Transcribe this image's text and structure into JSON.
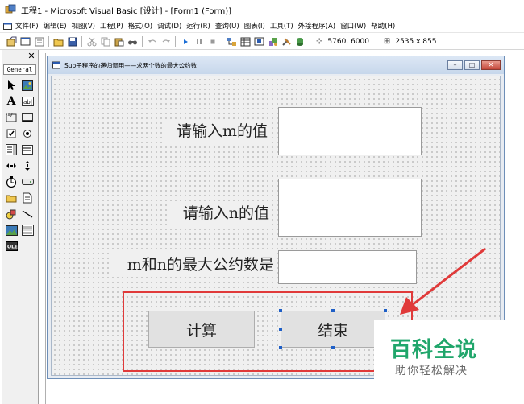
{
  "window": {
    "title": "工程1 - Microsoft Visual Basic [设计] - [Form1 (Form)]"
  },
  "menu": {
    "items": [
      "文件(F)",
      "编辑(E)",
      "视图(V)",
      "工程(P)",
      "格式(O)",
      "调试(D)",
      "运行(R)",
      "查询(U)",
      "图表(I)",
      "工具(T)",
      "外接程序(A)",
      "窗口(W)",
      "帮助(H)"
    ]
  },
  "toolbar": {
    "position_readout": "5760, 6000",
    "size_readout": "2535 x 855"
  },
  "toolbox": {
    "tab_label": "General",
    "close_glyph": "✕",
    "tools": [
      {
        "name": "pointer-tool-icon",
        "glyph": "↖"
      },
      {
        "name": "picturebox-tool-icon",
        "glyph": "▣"
      },
      {
        "name": "label-tool-icon",
        "glyph": "A"
      },
      {
        "name": "textbox-tool-icon",
        "glyph": "ab"
      },
      {
        "name": "frame-tool-icon",
        "glyph": "⊟"
      },
      {
        "name": "commandbutton-tool-icon",
        "glyph": "▭"
      },
      {
        "name": "checkbox-tool-icon",
        "glyph": "☑"
      },
      {
        "name": "optionbutton-tool-icon",
        "glyph": "◉"
      },
      {
        "name": "combobox-tool-icon",
        "glyph": "☰"
      },
      {
        "name": "listbox-tool-icon",
        "glyph": "≣"
      },
      {
        "name": "hscrollbar-tool-icon",
        "glyph": "◂▸"
      },
      {
        "name": "vscrollbar-tool-icon",
        "glyph": "⇕"
      },
      {
        "name": "timer-tool-icon",
        "glyph": "⏱"
      },
      {
        "name": "drivelistbox-tool-icon",
        "glyph": "⊖"
      },
      {
        "name": "dirlistbox-tool-icon",
        "glyph": "📁"
      },
      {
        "name": "filelistbox-tool-icon",
        "glyph": "🗎"
      },
      {
        "name": "shape-tool-icon",
        "glyph": "◈"
      },
      {
        "name": "line-tool-icon",
        "glyph": "╲"
      },
      {
        "name": "image-tool-icon",
        "glyph": "🖾"
      },
      {
        "name": "data-tool-icon",
        "glyph": "▤"
      },
      {
        "name": "ole-tool-icon",
        "glyph": "OLE"
      }
    ]
  },
  "form": {
    "caption": "Sub子程序的递归调用——求两个数的最大公约数",
    "label_m": "请输入m的值",
    "label_n": "请输入n的值",
    "label_gcd": "m和n的最大公约数是",
    "button_calc": "计算",
    "button_end": "结束"
  },
  "watermark": {
    "main": "百科全说",
    "sub": "助你轻松解决"
  },
  "colors": {
    "highlight_border": "#e03a3a",
    "watermark_green": "#20a66b",
    "selection_handle": "#1f5fc6"
  }
}
